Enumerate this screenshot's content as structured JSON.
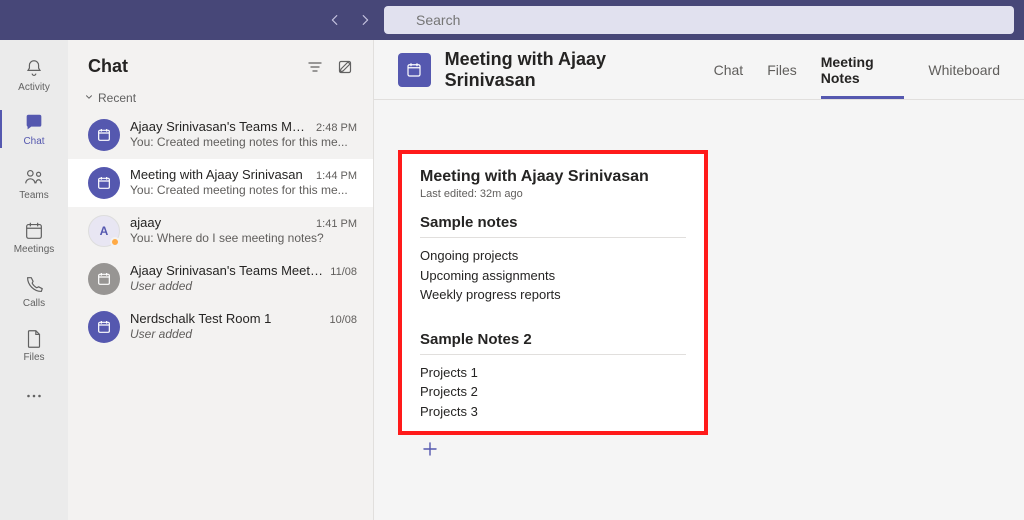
{
  "search": {
    "placeholder": "Search"
  },
  "rail": {
    "items": [
      {
        "id": "activity",
        "label": "Activity"
      },
      {
        "id": "chat",
        "label": "Chat"
      },
      {
        "id": "teams",
        "label": "Teams"
      },
      {
        "id": "meetings",
        "label": "Meetings"
      },
      {
        "id": "calls",
        "label": "Calls"
      },
      {
        "id": "files",
        "label": "Files"
      }
    ]
  },
  "chat_panel": {
    "title": "Chat",
    "section": "Recent",
    "items": [
      {
        "name": "Ajaay Srinivasan's Teams Mee...",
        "time": "2:48 PM",
        "preview": "You: Created meeting notes for this me...",
        "avatar": "purple",
        "icon": "calendar"
      },
      {
        "name": "Meeting with Ajaay Srinivasan",
        "time": "1:44 PM",
        "preview": "You: Created meeting notes for this me...",
        "avatar": "purple",
        "icon": "calendar",
        "selected": true
      },
      {
        "name": "ajaay",
        "time": "1:41 PM",
        "preview": "You: Where do I see meeting notes?",
        "avatar": "lilac",
        "initial": "A",
        "presence": true
      },
      {
        "name": "Ajaay Srinivasan's Teams Meeting",
        "time": "11/08",
        "preview": "User added",
        "avatar": "gray",
        "icon": "calendar",
        "italic": true
      },
      {
        "name": "Nerdschalk Test Room 1",
        "time": "10/08",
        "preview": "User added",
        "avatar": "purple",
        "icon": "calendar",
        "italic": true
      }
    ]
  },
  "content": {
    "title": "Meeting with Ajaay Srinivasan",
    "tabs": [
      "Chat",
      "Files",
      "Meeting Notes",
      "Whiteboard"
    ],
    "active_tab": 2
  },
  "notes": {
    "title": "Meeting with Ajaay Srinivasan",
    "edited": "Last edited: 32m ago",
    "sections": [
      {
        "heading": "Sample notes",
        "lines": [
          "Ongoing projects",
          "Upcoming assignments",
          "Weekly progress reports"
        ]
      },
      {
        "heading": "Sample Notes 2",
        "lines": [
          "Projects 1",
          "Projects 2",
          "Projects 3"
        ]
      }
    ]
  }
}
